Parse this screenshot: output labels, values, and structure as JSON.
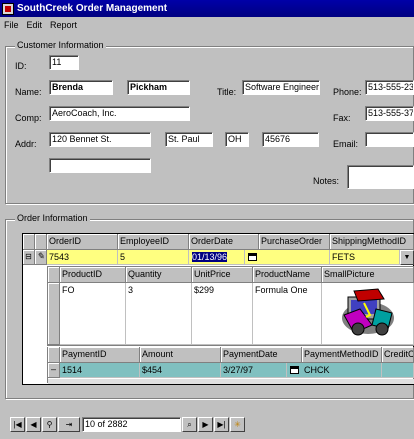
{
  "window": {
    "title": "SouthCreek Order Management"
  },
  "menu": [
    "File",
    "Edit",
    "Report"
  ],
  "customer": {
    "group_title": "Customer Information",
    "id_label": "ID:",
    "id": "11",
    "name_label": "Name:",
    "first_name": "Brenda",
    "last_name": "Pickham",
    "title_label": "Title:",
    "title": "Software Engineer",
    "phone_label": "Phone:",
    "phone": "513-555-23",
    "comp_label": "Comp:",
    "company": "AeroCoach, Inc.",
    "fax_label": "Fax:",
    "fax": "513-555-37",
    "addr_label": "Addr:",
    "address": "120 Bennet St.",
    "city": "St. Paul",
    "state": "OH",
    "zip": "45676",
    "email_label": "Email:",
    "email": "",
    "address2": "",
    "notes_label": "Notes:",
    "notes": ""
  },
  "order": {
    "group_title": "Order Information",
    "columns": [
      "OrderID",
      "EmployeeID",
      "OrderDate",
      "PurchaseOrder",
      "ShippingMethodID"
    ],
    "row": {
      "order_id": "7543",
      "employee_id": "5",
      "order_date": "01/13/96",
      "purchase_order": "",
      "shipping": "FETS"
    },
    "detail_columns": [
      "ProductID",
      "Quantity",
      "UnitPrice",
      "ProductName",
      "SmallPicture"
    ],
    "detail_row": {
      "product_id": "FO",
      "quantity": "3",
      "unit_price": "$299",
      "product_name": "Formula One"
    },
    "payment_columns": [
      "PaymentID",
      "Amount",
      "PaymentDate",
      "PaymentMethodID",
      "CreditC"
    ],
    "payment_row": {
      "payment_id": "1514",
      "amount": "$454",
      "payment_date": "3/27/97",
      "method": "CHCK",
      "credit": ""
    }
  },
  "navigator": {
    "record_text": "10 of 2882"
  },
  "icons": [
    "app-icon",
    "expand-icon",
    "calendar-icon",
    "dropdown-arrow-icon",
    "first-record-icon",
    "prev-record-icon",
    "find-icon",
    "new-icon",
    "next-record-icon",
    "last-record-icon",
    "filter-icon",
    "binoculars-icon"
  ]
}
